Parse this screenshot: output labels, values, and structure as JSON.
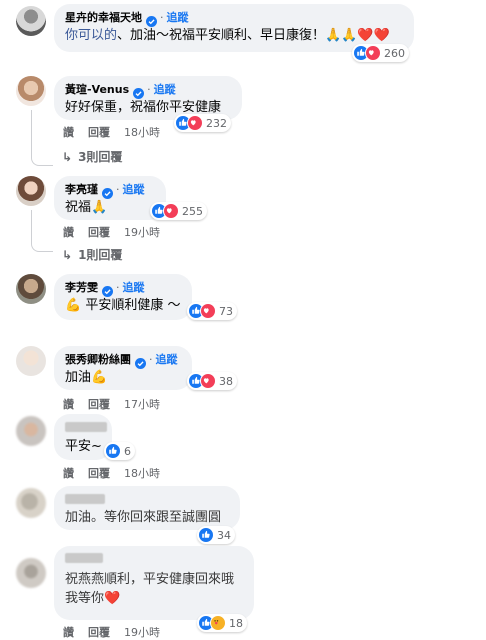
{
  "colors": {
    "accent": "#1877f2",
    "bubble": "#f0f2f5",
    "muted": "#65676b",
    "like": "#1877f2",
    "love": "#f33e58",
    "care": "#f7b125"
  },
  "actions": {
    "like": "讚",
    "reply": "回覆"
  },
  "follow_label": "追蹤",
  "dot": "·",
  "comments": [
    {
      "name": "星卉的幸福天地",
      "verified": true,
      "text": "你可以的、加油～祝福平安順利、早日康復！🙏🙏❤️❤️",
      "text_link_part": "你可以的",
      "reactions": [
        "like-icon",
        "love-icon"
      ],
      "reaction_count": "260",
      "time": ""
    },
    {
      "name": "黃瑄-Venus",
      "verified": true,
      "text": "好好保重，祝福你平安健康",
      "reactions": [
        "like-icon",
        "love-icon"
      ],
      "reaction_count": "232",
      "time": "18小時",
      "replies": "3則回覆"
    },
    {
      "name": "李亮瑾",
      "verified": true,
      "text": "祝福🙏",
      "reactions": [
        "like-icon",
        "love-icon"
      ],
      "reaction_count": "255",
      "time": "19小時",
      "replies": "1則回覆"
    },
    {
      "name": "李芳雯",
      "verified": true,
      "text": "💪 平安順利健康 ～",
      "reactions": [
        "like-icon",
        "love-icon"
      ],
      "reaction_count": "73",
      "time": "19小時"
    },
    {
      "name": "張秀卿粉絲團",
      "verified": true,
      "text": "加油💪",
      "reactions": [
        "like-icon",
        "love-icon"
      ],
      "reaction_count": "38",
      "time": "17小時"
    },
    {
      "name": "",
      "verified": false,
      "text": "平安~",
      "reactions": [
        "like-icon"
      ],
      "reaction_count": "6",
      "time": "18小時"
    },
    {
      "name": "",
      "verified": false,
      "text": "加油。等你回來跟至誠團圓",
      "reactions": [
        "like-icon"
      ],
      "reaction_count": "34",
      "time": ""
    },
    {
      "name": "",
      "verified": false,
      "text_line1": "祝燕燕順利，平安健康回來哦",
      "text_line2": "我等你❤️",
      "reactions": [
        "like-icon",
        "care-icon"
      ],
      "reaction_count": "18",
      "time": "19小時"
    }
  ]
}
